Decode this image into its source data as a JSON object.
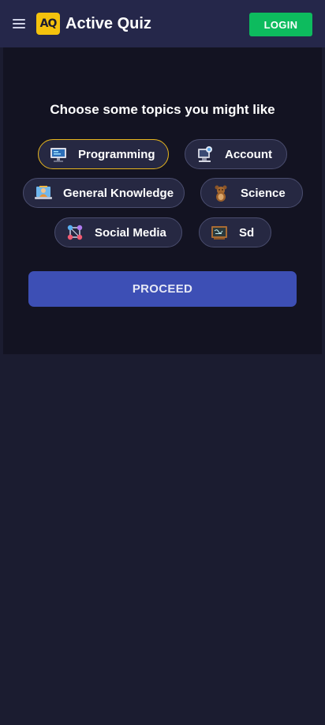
{
  "header": {
    "menu_icon": "hamburger-menu-icon",
    "logo_text": "AQ",
    "brand": "Active Quiz",
    "login_label": "LOGIN",
    "colors": {
      "bar": "#25274a",
      "logo": "#f4c20d",
      "login": "#0dbb5e"
    }
  },
  "topics": {
    "title": "Choose some topics you might like",
    "items": [
      {
        "label": "Programming",
        "icon": "computer-monitor-icon",
        "selected": true
      },
      {
        "label": "Account",
        "icon": "accountant-desk-icon",
        "selected": false
      },
      {
        "label": "General Knowledge",
        "icon": "laptop-teacher-icon",
        "selected": false
      },
      {
        "label": "Science",
        "icon": "brown-bear-icon",
        "selected": false
      },
      {
        "label": "Social Media",
        "icon": "network-nodes-icon",
        "selected": false
      },
      {
        "label": "Sd",
        "icon": "chalkboard-icon",
        "selected": false
      }
    ],
    "selected_border_color": "#e6b51e"
  },
  "actions": {
    "proceed_label": "PROCEED",
    "proceed_color": "#3d4fb5"
  }
}
